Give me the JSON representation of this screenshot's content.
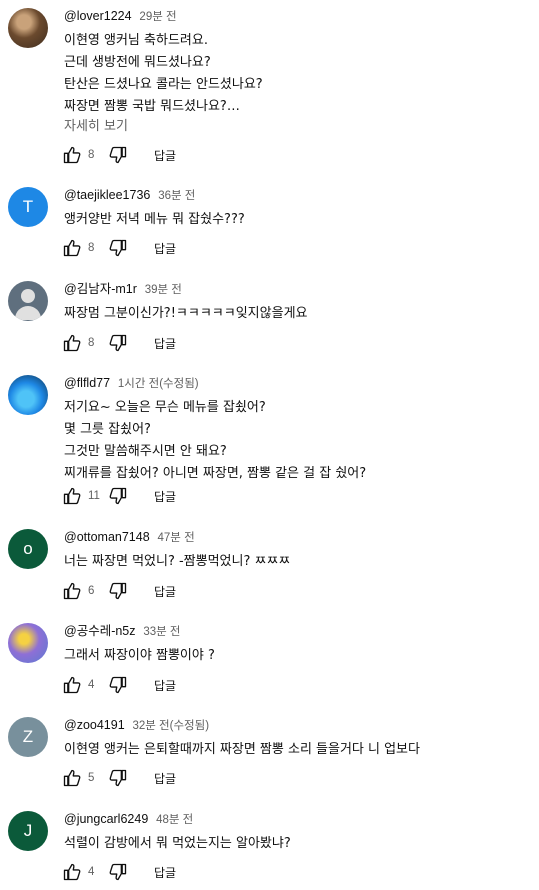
{
  "comments": [
    {
      "author": "@lover1224",
      "time": "29분 전",
      "lines": [
        "이현영 앵커님 축하드려요.",
        "근데 생방전에 뭐드셨나요?",
        "탄산은 드셨나요 콜라는 안드셨나요?",
        "짜장면 짬뽕 국밥 뭐드셨나요?…"
      ],
      "more": "자세히 보기",
      "likes": "8",
      "reply": "답글",
      "avatar": {
        "type": "photo",
        "letter": ""
      }
    },
    {
      "author": "@taejiklee1736",
      "time": "36분 전",
      "lines": [
        "앵커양반 저녁 메뉴 뭐 잡쉈수???"
      ],
      "likes": "8",
      "reply": "답글",
      "avatar": {
        "type": "letter",
        "letter": "T",
        "color": "#1e88e5"
      }
    },
    {
      "author": "@김남자-m1r",
      "time": "39분 전",
      "lines": [
        "짜장멈 그분이신가?!ㅋㅋㅋㅋㅋ잊지않을게요"
      ],
      "likes": "8",
      "reply": "답글",
      "avatar": {
        "type": "default",
        "letter": ""
      }
    },
    {
      "author": "@flfld77",
      "time": "1시간 전(수정됨)",
      "lines": [
        "저기요~ 오늘은 무슨 메뉴를 잡쇴어?",
        "몇 그릇 잡쇴어?",
        "그것만 말씀해주시면 안 돼요?",
        "찌개류를 잡쇴어? 아니면 짜장면, 짬뽕 같은 걸 잡 쉈어?"
      ],
      "likes": "11",
      "reply": "답글",
      "avatar": {
        "type": "photo",
        "letter": ""
      }
    },
    {
      "author": "@ottoman7148",
      "time": "47분 전",
      "lines": [
        "너는 짜장면 먹었니? -짬뽕먹었니? ㅉㅉㅉ"
      ],
      "likes": "6",
      "reply": "답글",
      "avatar": {
        "type": "letter",
        "letter": "o",
        "color": "#0b5a3a"
      }
    },
    {
      "author": "@공수레-n5z",
      "time": "33분 전",
      "lines": [
        "그래서 짜장이야 짬뽕이야 ?"
      ],
      "likes": "4",
      "reply": "답글",
      "avatar": {
        "type": "photo",
        "letter": ""
      }
    },
    {
      "author": "@zoo4191",
      "time": "32분 전(수정됨)",
      "lines": [
        "이현영 앵커는 은퇴할때까지 짜장면 짬뽕 소리 들을거다 니 업보다"
      ],
      "likes": "5",
      "reply": "답글",
      "avatar": {
        "type": "letter",
        "letter": "Z",
        "color": "#78909c"
      }
    },
    {
      "author": "@jungcarl6249",
      "time": "48분 전",
      "lines": [
        "석렬이 감방에서 뭐 먹었는지는 알아봤냐?"
      ],
      "likes": "4",
      "reply": "답글",
      "avatar": {
        "type": "letter",
        "letter": "J",
        "color": "#0b5a3a"
      }
    }
  ]
}
